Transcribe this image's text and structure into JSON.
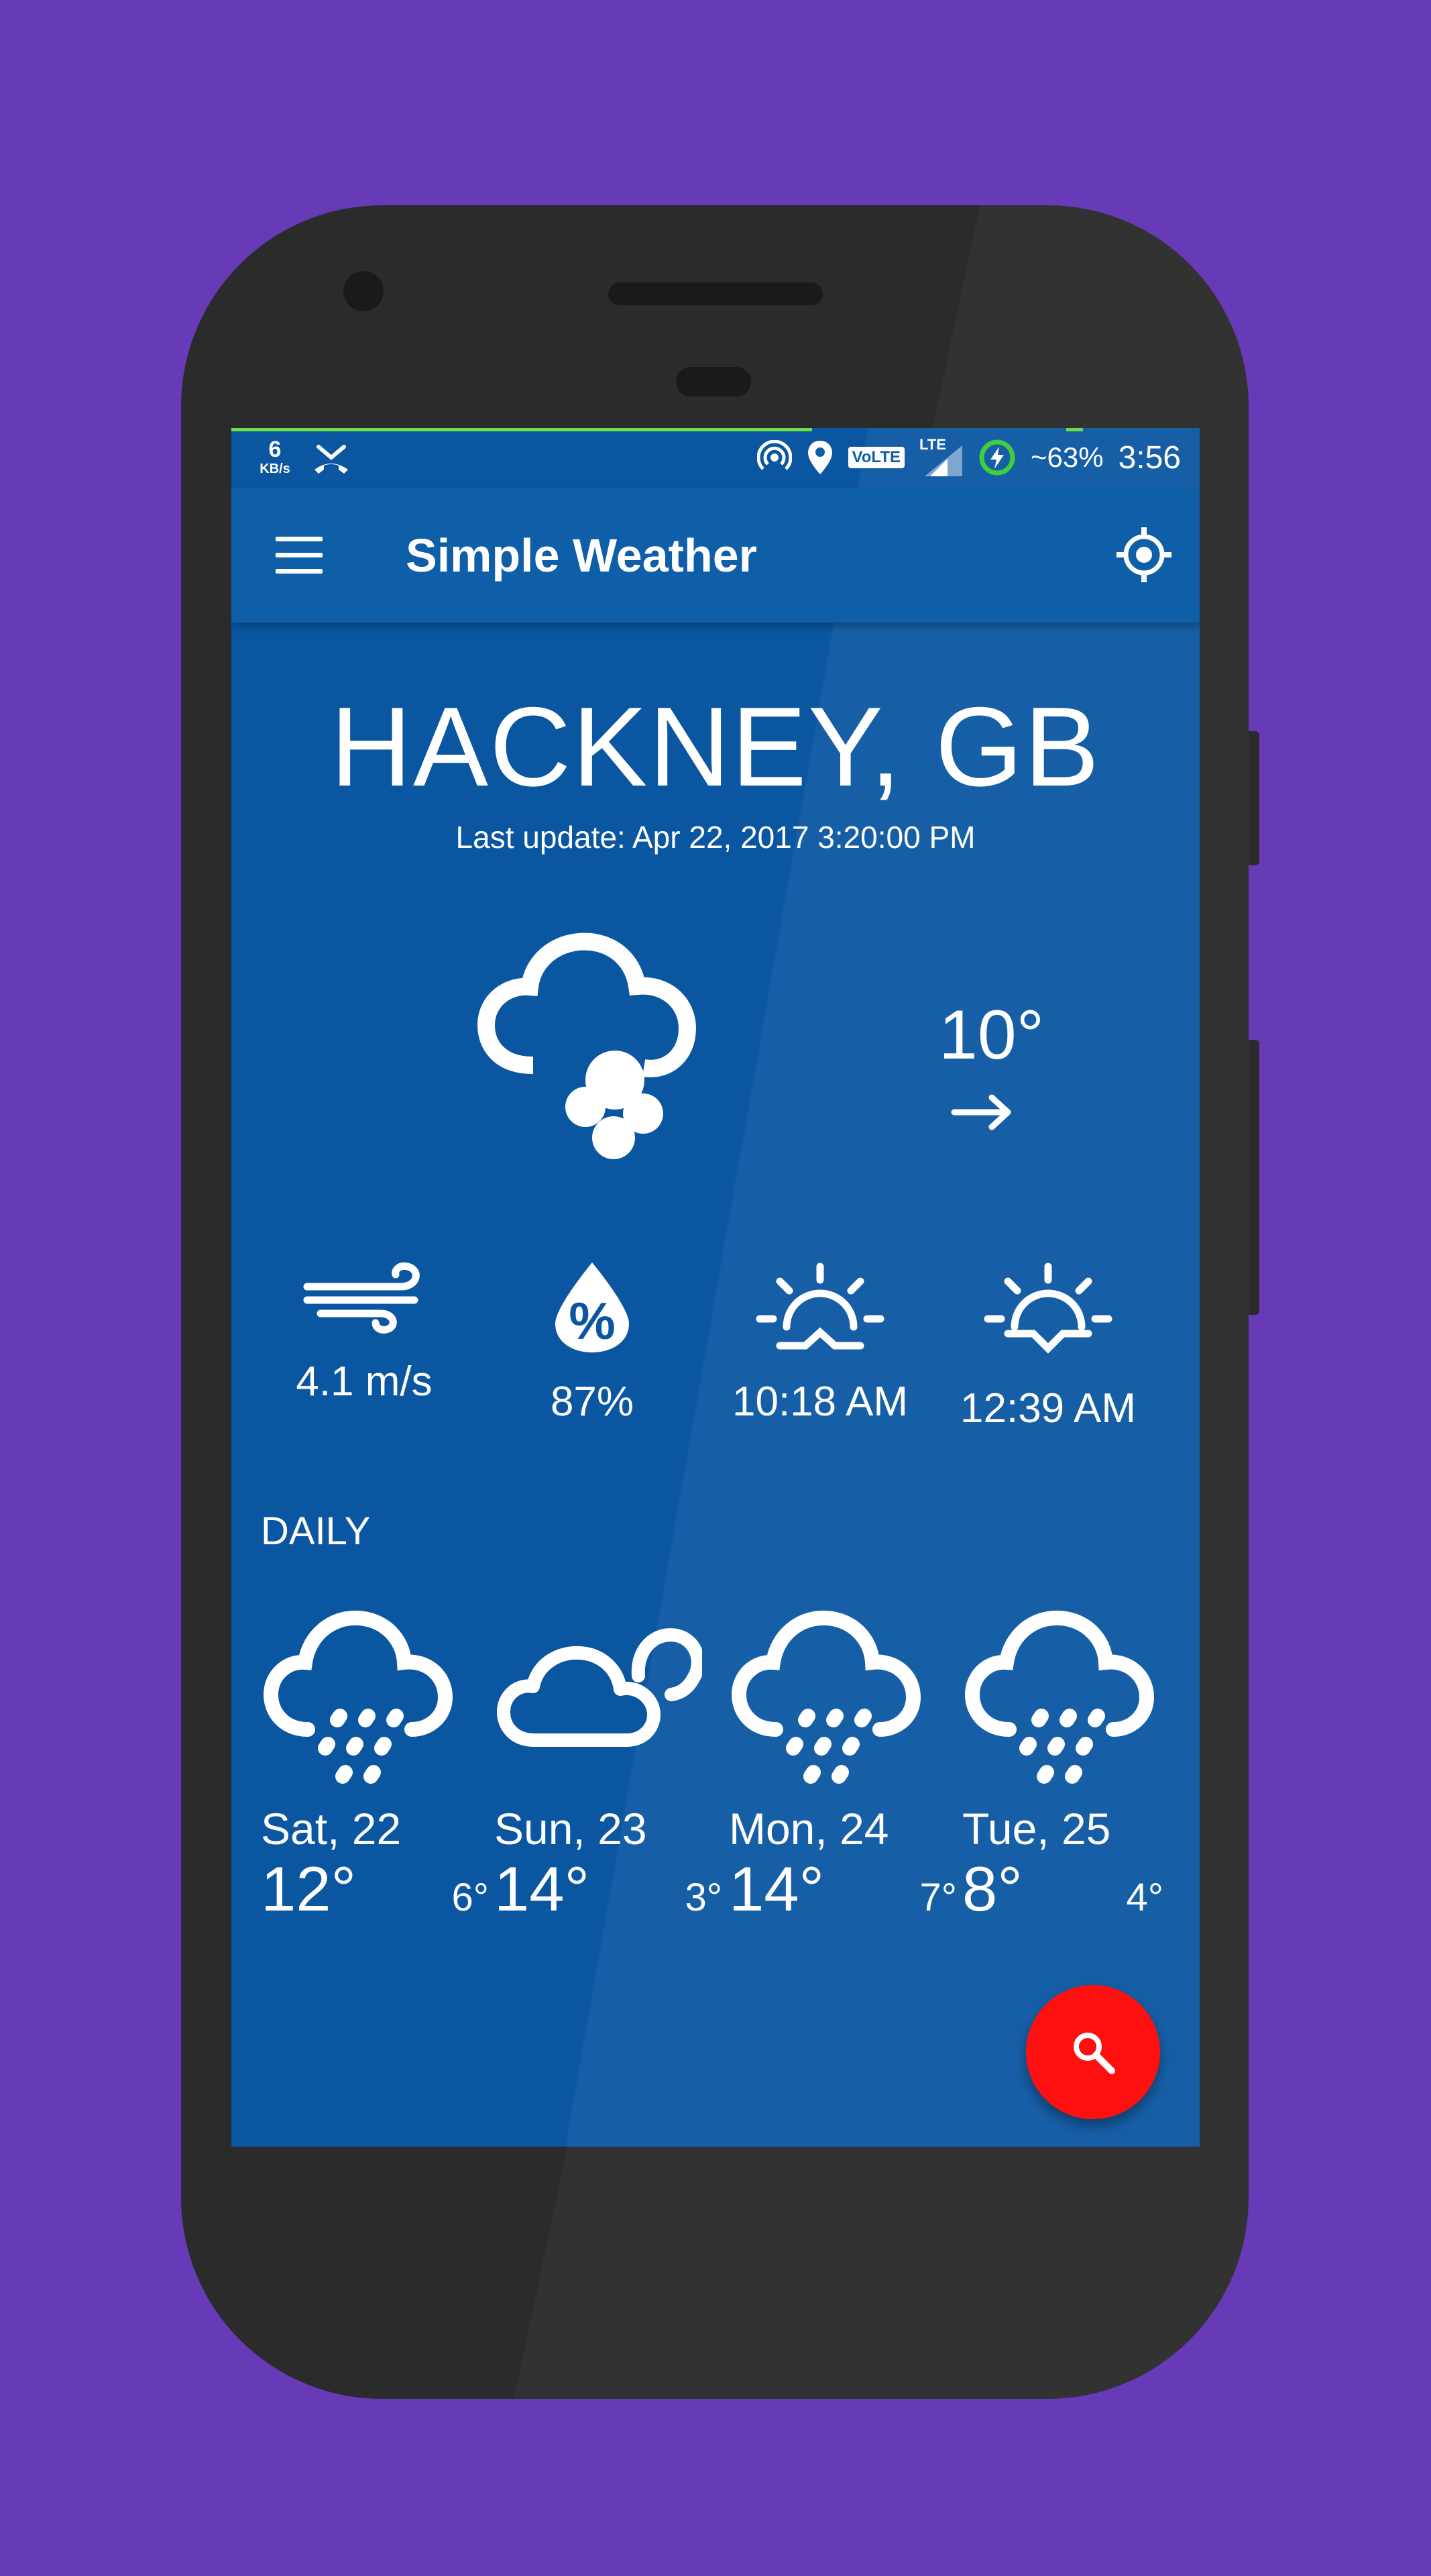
{
  "status_bar": {
    "speed_value": "6",
    "speed_unit": "KB/s",
    "battery": "~63%",
    "time": "3:56",
    "volte": "VoLTE",
    "lte": "LTE"
  },
  "toolbar": {
    "title": "Simple Weather",
    "menu_icon": "menu-icon",
    "locate_icon": "locate-icon"
  },
  "location": {
    "city": "HACKNEY, GB",
    "last_update": "Last update: Apr 22, 2017 3:20:00 PM"
  },
  "current": {
    "icon": "fog-cloud-icon",
    "temperature": "10°",
    "wind_direction_icon": "arrow-right-icon"
  },
  "stats": [
    {
      "icon": "wind-icon",
      "value": "4.1 m/s"
    },
    {
      "icon": "humidity-icon",
      "value": "87%"
    },
    {
      "icon": "sunrise-icon",
      "value": "10:18 AM"
    },
    {
      "icon": "sunset-icon",
      "value": "12:39 AM"
    }
  ],
  "daily": {
    "title": "DAILY",
    "days": [
      {
        "name": "Sat, 22",
        "high": "12°",
        "low": "6°",
        "icon": "rain-icon"
      },
      {
        "name": "Sun, 23",
        "high": "14°",
        "low": "3°",
        "icon": "cloudy-icon"
      },
      {
        "name": "Mon, 24",
        "high": "14°",
        "low": "7°",
        "icon": "rain-icon"
      },
      {
        "name": "Tue, 25",
        "high": "8°",
        "low": "4°",
        "icon": "rain-icon"
      }
    ]
  },
  "fab": {
    "icon": "search-icon"
  },
  "colors": {
    "background": "#673ab7",
    "screen": "#0a56a1",
    "toolbar": "#0f5ea8",
    "fab": "#ff1010",
    "status_line": "#6fdc4a"
  }
}
